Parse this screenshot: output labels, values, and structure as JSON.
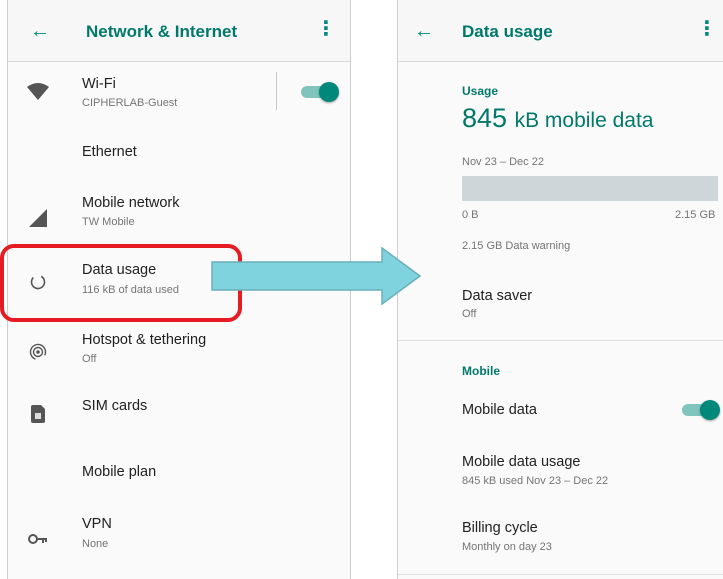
{
  "left_screen": {
    "header": {
      "back_icon": "arrow-left-icon",
      "title": "Network & Internet",
      "more_icon": "overflow-menu-icon"
    },
    "items": [
      {
        "icon": "wifi-icon",
        "title": "Wi-Fi",
        "subtitle": "CIPHERLAB-Guest",
        "toggle": "on"
      },
      {
        "icon": "",
        "title": "Ethernet",
        "subtitle": ""
      },
      {
        "icon": "signal-icon",
        "title": "Mobile network",
        "subtitle": "TW Mobile"
      },
      {
        "icon": "data-usage-icon",
        "title": "Data usage",
        "subtitle": "116 kB of data used",
        "highlighted": true
      },
      {
        "icon": "hotspot-icon",
        "title": "Hotspot & tethering",
        "subtitle": "Off"
      },
      {
        "icon": "sim-card-icon",
        "title": "SIM cards",
        "subtitle": ""
      },
      {
        "icon": "",
        "title": "Mobile plan",
        "subtitle": ""
      },
      {
        "icon": "vpn-key-icon",
        "title": "VPN",
        "subtitle": "None"
      }
    ]
  },
  "right_screen": {
    "header": {
      "back_icon": "arrow-left-icon",
      "title": "Data usage",
      "more_icon": "overflow-menu-icon"
    },
    "usage": {
      "section_label": "Usage",
      "amount": "845",
      "amount_unit": "kB mobile data",
      "period": "Nov 23 – Dec 22",
      "bar_min_label": "0 B",
      "bar_max_label": "2.15 GB",
      "warning": "2.15 GB Data warning"
    },
    "data_saver": {
      "title": "Data saver",
      "subtitle": "Off"
    },
    "mobile": {
      "section_label": "Mobile",
      "mobile_data": {
        "title": "Mobile data",
        "toggle": "on"
      },
      "mobile_data_usage": {
        "title": "Mobile data usage",
        "subtitle": "845 kB used Nov 23 – Dec 22"
      },
      "billing_cycle": {
        "title": "Billing cycle",
        "subtitle": "Monthly on day 23"
      }
    }
  },
  "colors": {
    "accent": "#00796b",
    "highlight": "#e51c23",
    "arrow_fill": "#7fd3de"
  }
}
